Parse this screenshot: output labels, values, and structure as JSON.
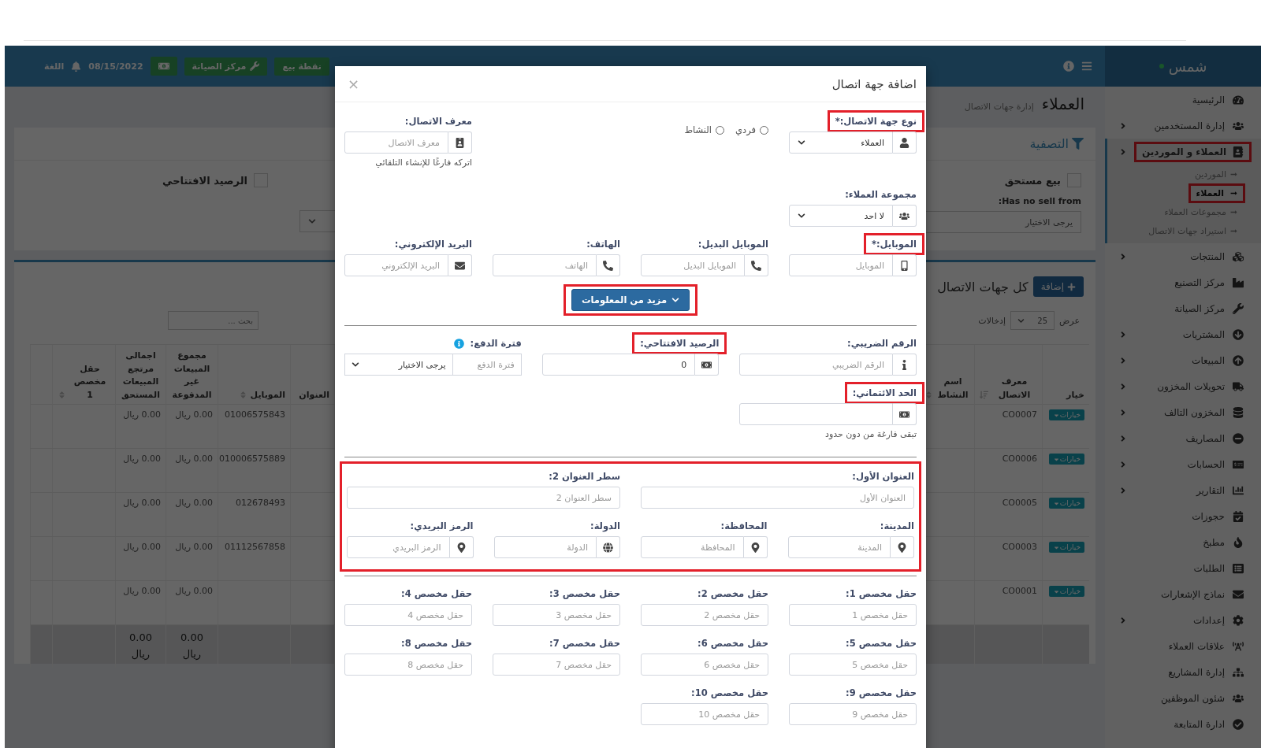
{
  "header": {
    "buttons": [
      {
        "label": "نقطة بيع"
      },
      {
        "label": "مركز الصيانة"
      }
    ],
    "date": "08/15/2022",
    "language": "اللغة"
  },
  "sidebar": {
    "brand": "شمس",
    "items": [
      {
        "label": "الرئيسية",
        "expandable": false,
        "selected": false
      },
      {
        "label": "إدارة المستخدمين",
        "expandable": true,
        "selected": false
      },
      {
        "label": "العملاء و الموردين",
        "expandable": true,
        "selected": true,
        "highlighted": true,
        "children": [
          {
            "label": "الموردين",
            "selected": false
          },
          {
            "label": "العملاء",
            "selected": true,
            "highlighted": true
          },
          {
            "label": "مجموعات العملاء",
            "selected": false
          },
          {
            "label": "استيراد جهات الاتصال",
            "selected": false
          }
        ]
      },
      {
        "label": "المنتجات",
        "expandable": true,
        "selected": false
      },
      {
        "label": "مركز التصنيع",
        "expandable": false,
        "selected": false
      },
      {
        "label": "مركز الصيانة",
        "expandable": false,
        "selected": false
      },
      {
        "label": "المشتريات",
        "expandable": true,
        "selected": false
      },
      {
        "label": "المبيعات",
        "expandable": true,
        "selected": false
      },
      {
        "label": "تحويلات المخزون",
        "expandable": true,
        "selected": false
      },
      {
        "label": "المخزون التالف",
        "expandable": true,
        "selected": false
      },
      {
        "label": "المصاريف",
        "expandable": true,
        "selected": false
      },
      {
        "label": "الحسابات",
        "expandable": true,
        "selected": false
      },
      {
        "label": "التقارير",
        "expandable": true,
        "selected": false
      },
      {
        "label": "حجوزات",
        "expandable": false,
        "selected": false
      },
      {
        "label": "مطبخ",
        "expandable": false,
        "selected": false
      },
      {
        "label": "الطلبات",
        "expandable": false,
        "selected": false
      },
      {
        "label": "نماذج الإشعارات",
        "expandable": false,
        "selected": false
      },
      {
        "label": "إعدادات",
        "expandable": true,
        "selected": false
      },
      {
        "label": "علاقات العملاء",
        "expandable": false,
        "selected": false
      },
      {
        "label": "إدارة المشاريع",
        "expandable": false,
        "selected": false
      },
      {
        "label": "شئون الموظفين",
        "expandable": false,
        "selected": false
      },
      {
        "label": "ادارة المتابعة",
        "expandable": false,
        "selected": false
      }
    ]
  },
  "page": {
    "title": "العملاء",
    "subtitle": "إدارة جهات الاتصال"
  },
  "filters": {
    "title": "التصفية",
    "due_sale": {
      "label": "بيع مستحق",
      "checked": false
    },
    "opening_balance": {
      "label": "الرصيد الافتتاحي",
      "checked": false
    },
    "select_label": "Has no sell from:",
    "select_placeholder": "يرجى الاختيار"
  },
  "contacts": {
    "title": "كل جهات الاتصال",
    "add_button": "إضافة",
    "show_label": "عرض",
    "page_size": "25",
    "entries_label": "إدخالات",
    "search_placeholder": "بحث ...",
    "columns_right": [
      {
        "label": "خيار",
        "sortable": false
      },
      {
        "label": "معرف الاتصال",
        "sortable": true
      },
      {
        "label": "اسم النشاط",
        "sortable": true
      }
    ],
    "columns_left": [
      {
        "label": "العنوان",
        "sortable": false
      },
      {
        "label": "الموبايل",
        "sortable": true
      },
      {
        "label": "مجموع المبيعات غير المدفوعة",
        "sortable": false
      },
      {
        "label": "اجمالى مرتجع المبيعات المستحق",
        "sortable": false
      },
      {
        "label": "حقل مخصص 1",
        "sortable": true
      }
    ],
    "rows": [
      {
        "action": "خيارات",
        "contact_id": "CO0007",
        "mobile": "01006575843",
        "unpaid": "0.00 ريال",
        "returns": "0.00 ريال"
      },
      {
        "action": "خيارات",
        "contact_id": "CO0006",
        "mobile": "010006575889",
        "unpaid": "0.00 ريال",
        "returns": "0.00 ريال"
      },
      {
        "action": "خيارات",
        "contact_id": "CO0005",
        "mobile": "012678493",
        "unpaid": "0.00 ريال",
        "returns": "0.00 ريال"
      },
      {
        "action": "خيارات",
        "contact_id": "CO0003",
        "mobile": "01112567858",
        "unpaid": "0.00 ريال",
        "returns": "0.00 ريال"
      },
      {
        "action": "خيارات",
        "contact_id": "CO0001",
        "unpaid": "0.00 ريال",
        "returns": "0.00 ريال"
      }
    ],
    "totals": {
      "unpaid": "0.00 ريال",
      "returns": "0.00 ريال"
    }
  },
  "modal": {
    "title": "اضافة جهة اتصال",
    "close": "×",
    "contact_type": {
      "label": "نوع جهة الاتصال:*",
      "value": "العملاء",
      "highlighted": true
    },
    "entity_options": [
      {
        "label": "فردي",
        "selected": false
      },
      {
        "label": "النشاط",
        "selected": false
      }
    ],
    "contact_id": {
      "label": "معرف الاتصال:",
      "placeholder": "معرف الاتصال",
      "help": "اتركه فارغًا للإنشاء التلقائي"
    },
    "customer_group": {
      "label": "مجموعة العملاء:",
      "value": "لا احد"
    },
    "contact_fields": [
      {
        "label": "الموبايل:*",
        "placeholder": "الموبايل",
        "highlighted": true
      },
      {
        "label": "الموبايل البديل:",
        "placeholder": "الموبايل البديل"
      },
      {
        "label": "الهاتف:",
        "placeholder": "الهاتف"
      },
      {
        "label": "البريد الإلكتروني:",
        "placeholder": "البريد الإلكتروني"
      }
    ],
    "more_button": {
      "label": "مزيد من المعلومات",
      "highlighted": true
    },
    "tax_number": {
      "label": "الرقم الضريبي:",
      "placeholder": "الرقم الضريبي"
    },
    "opening_balance": {
      "label": "الرصيد الافتتاحي:",
      "value": "0",
      "highlighted": true
    },
    "pay_term": {
      "label": "فترة الدفع:",
      "placeholder": "فترة الدفع",
      "select": "يرجى الاختيار"
    },
    "credit_limit": {
      "label": "الحد الائتماني:",
      "help": "تبقى فارغة من دون حدود",
      "highlighted": true
    },
    "address": {
      "highlighted": true,
      "lines": [
        {
          "label": "العنوان الأول:",
          "placeholder": "العنوان الأول"
        },
        {
          "label": "سطر العنوان 2:",
          "placeholder": "سطر العنوان 2"
        }
      ],
      "fields": [
        {
          "label": "المدينة:",
          "placeholder": "المدينة"
        },
        {
          "label": "المحافظة:",
          "placeholder": "المحافظة"
        },
        {
          "label": "الدولة:",
          "placeholder": "الدولة"
        },
        {
          "label": "الرمز البريدي:",
          "placeholder": "الرمز البريدي"
        }
      ]
    },
    "custom_fields": [
      {
        "label": "حقل مخصص 1:",
        "placeholder": "حقل مخصص 1"
      },
      {
        "label": "حقل مخصص 2:",
        "placeholder": "حقل مخصص 2"
      },
      {
        "label": "حقل مخصص 3:",
        "placeholder": "حقل مخصص 3"
      },
      {
        "label": "حقل مخصص 4:",
        "placeholder": "حقل مخصص 4"
      },
      {
        "label": "حقل مخصص 5:",
        "placeholder": "حقل مخصص 5"
      },
      {
        "label": "حقل مخصص 6:",
        "placeholder": "حقل مخصص 6"
      },
      {
        "label": "حقل مخصص 7:",
        "placeholder": "حقل مخصص 7"
      },
      {
        "label": "حقل مخصص 8:",
        "placeholder": "حقل مخصص 8"
      },
      {
        "label": "حقل مخصص 9:",
        "placeholder": "حقل مخصص 9"
      },
      {
        "label": "حقل مخصص 10:",
        "placeholder": "حقل مخصص 10"
      }
    ]
  }
}
